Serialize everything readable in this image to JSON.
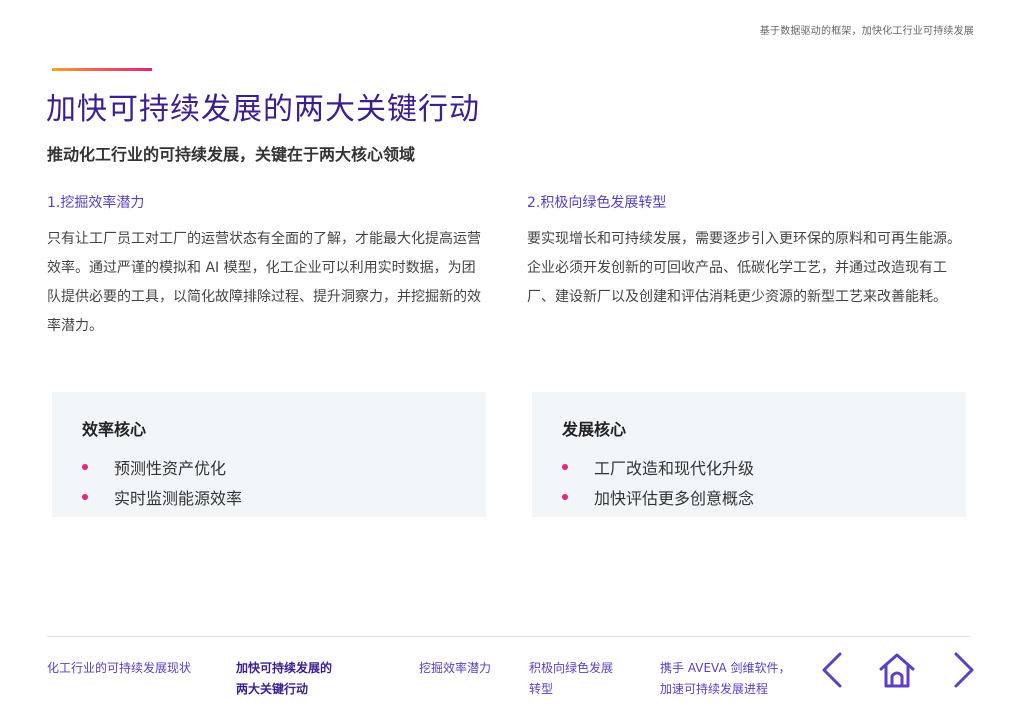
{
  "header": {
    "caption": "基于数据驱动的框架，加快化工行业可持续发展"
  },
  "title": "加快可持续发展的两大关键行动",
  "subtitle": "推动化工行业的可持续发展，关键在于两大核心领域",
  "columns": [
    {
      "heading": "1.挖掘效率潜力",
      "body": "只有让工厂员工对工厂的运营状态有全面的了解，才能最大化提高运营效率。通过严谨的模拟和 AI 模型，化工企业可以利用实时数据，为团队提供必要的工具，以简化故障排除过程、提升洞察力，并挖掘新的效率潜力。"
    },
    {
      "heading": "2.积极向绿色发展转型",
      "body": "要实现增长和可持续发展，需要逐步引入更环保的原料和可再生能源。企业必须开发创新的可回收产品、低碳化学工艺，并通过改造现有工厂、建设新厂以及创建和评估消耗更少资源的新型工艺来改善能耗。"
    }
  ],
  "cards": [
    {
      "title": "效率核心",
      "items": [
        "预测性资产优化",
        "实时监测能源效率"
      ]
    },
    {
      "title": "发展核心",
      "items": [
        "工厂改造和现代化升级",
        "加快评估更多创意概念"
      ]
    }
  ],
  "footer_nav": [
    {
      "lines": [
        "化工行业的可持续发展现状"
      ],
      "active": false
    },
    {
      "lines": [
        "加快可持续发展的",
        "两大关键行动"
      ],
      "active": true
    },
    {
      "lines": [
        "挖掘效率潜力"
      ],
      "active": false
    },
    {
      "lines": [
        "积极向绿色发展",
        "转型"
      ],
      "active": false
    },
    {
      "lines": [
        "携手 AVEVA 剑维软件，",
        "加速可持续发展进程"
      ],
      "active": false
    }
  ],
  "nav_icons": {
    "prev": "chevron-left-icon",
    "home": "home-icon",
    "next": "chevron-right-icon"
  },
  "colors": {
    "brand_purple": "#3b1f8f",
    "link_purple": "#5b3fc4",
    "accent_pink": "#e6247d",
    "accent_orange": "#f6a623",
    "card_bg": "#f3f6f8"
  }
}
